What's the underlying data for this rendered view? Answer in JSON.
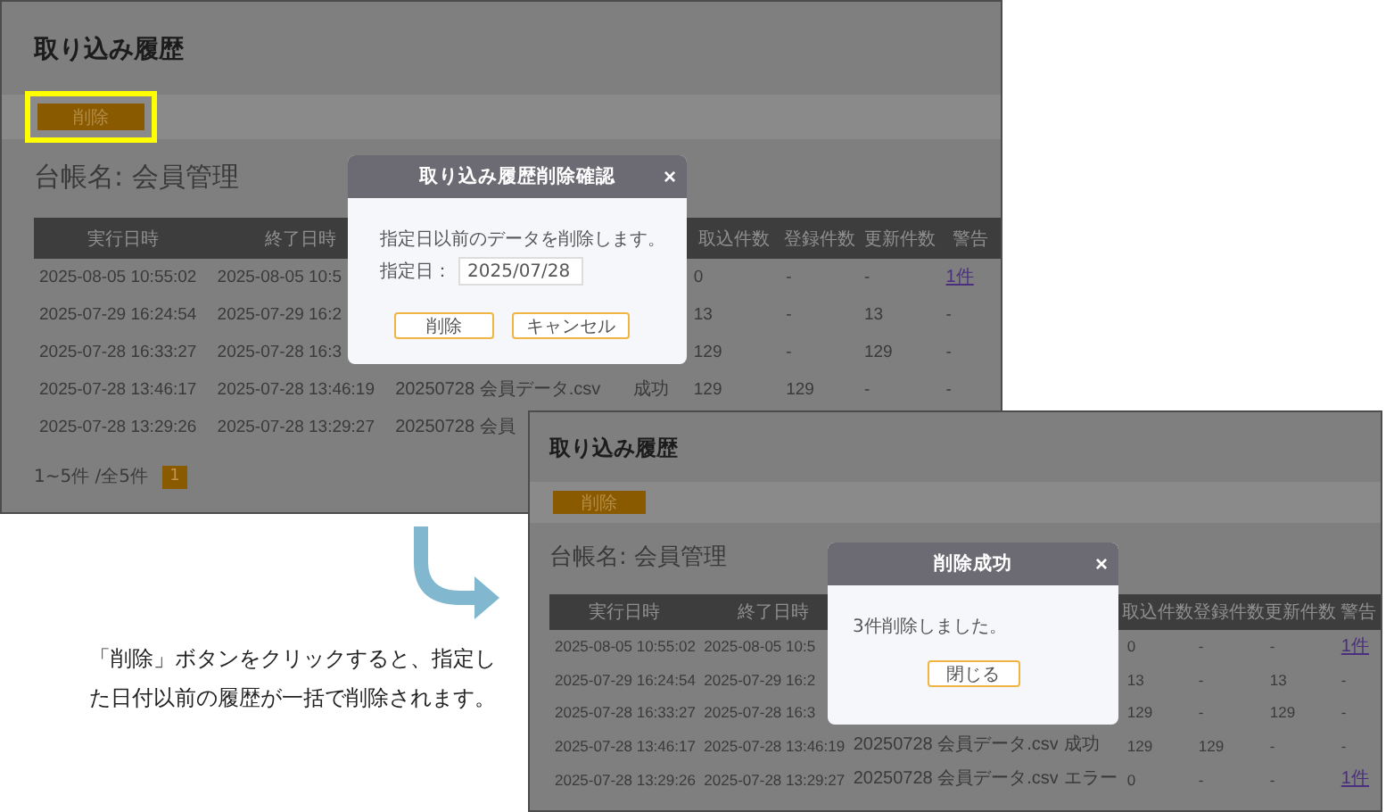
{
  "screens": [
    {
      "title": "取り込み履歴",
      "toolbar_button": {
        "label": "削除",
        "highlighted": true
      },
      "ledger": "台帳名: 会員管理",
      "table": {
        "columns": [
          "実行日時",
          "終了日時",
          null,
          null,
          "取込件数",
          "登録件数",
          "更新件数",
          "警告"
        ],
        "rows": [
          {
            "cells": [
              "2025-08-05 10:55:02",
              "2025-08-05 10:5",
              null,
              null,
              "0",
              "-",
              "-",
              {
                "kind": "link",
                "text": "1件"
              }
            ]
          },
          {
            "cells": [
              "2025-07-29 16:24:54",
              "2025-07-29 16:2",
              null,
              null,
              "13",
              "-",
              "13",
              "-"
            ]
          },
          {
            "cells": [
              "2025-07-28 16:33:27",
              "2025-07-28 16:3",
              null,
              null,
              "129",
              "-",
              "129",
              "-"
            ]
          },
          {
            "cells": [
              "2025-07-28 13:46:17",
              "2025-07-28 13:46:19",
              "20250728 会員データ.csv",
              "成功",
              "129",
              "129",
              "-",
              "-"
            ]
          },
          {
            "cells": [
              "2025-07-28 13:29:26",
              "2025-07-28 13:29:27",
              "20250728 会員",
              null,
              null,
              null,
              null,
              null
            ]
          }
        ]
      },
      "pagination": {
        "summary": "1~5件 /全5件",
        "pages": [
          {
            "label": "1",
            "selected": true
          }
        ]
      },
      "dialog": {
        "kind": "confirm",
        "title": "取り込み履歴削除確認",
        "close": "×",
        "message": "指定日以前のデータを削除します。",
        "date_field": {
          "label": "指定日：",
          "value": "2025/07/28"
        },
        "buttons": [
          "削除",
          "キャンセル"
        ]
      }
    },
    {
      "title": "取り込み履歴",
      "toolbar_button": {
        "label": "削除",
        "highlighted": false
      },
      "ledger": "台帳名: 会員管理",
      "table": {
        "columns": [
          "実行日時",
          "終了日時",
          null,
          null,
          "取込件数",
          "登録件数",
          "更新件数",
          "警告"
        ],
        "rows": [
          {
            "cells": [
              "2025-08-05 10:55:02",
              "2025-08-05 10:5",
              null,
              null,
              "0",
              "-",
              "-",
              {
                "kind": "link",
                "text": "1件"
              }
            ]
          },
          {
            "cells": [
              "2025-07-29 16:24:54",
              "2025-07-29 16:2",
              null,
              null,
              "13",
              "-",
              "13",
              "-"
            ]
          },
          {
            "cells": [
              "2025-07-28 16:33:27",
              "2025-07-28 16:3",
              null,
              null,
              "129",
              "-",
              "129",
              "-"
            ]
          },
          {
            "cells": [
              "2025-07-28 13:46:17",
              "2025-07-28 13:46:19",
              "20250728 会員データ.csv",
              "成功",
              "129",
              "129",
              "-",
              "-"
            ]
          },
          {
            "cells": [
              "2025-07-28 13:29:26",
              "2025-07-28 13:29:27",
              "20250728 会員データ.csv",
              "エラー",
              "0",
              "-",
              "-",
              {
                "kind": "link",
                "text": "1件"
              }
            ]
          }
        ]
      },
      "dialog": {
        "kind": "info",
        "title": "削除成功",
        "close": "×",
        "message": "3件削除しました。",
        "buttons": [
          "閉じる"
        ]
      }
    }
  ],
  "caption": "「削除」ボタンをクリックすると、指定した日付以前の履歴が一括で削除されます。"
}
